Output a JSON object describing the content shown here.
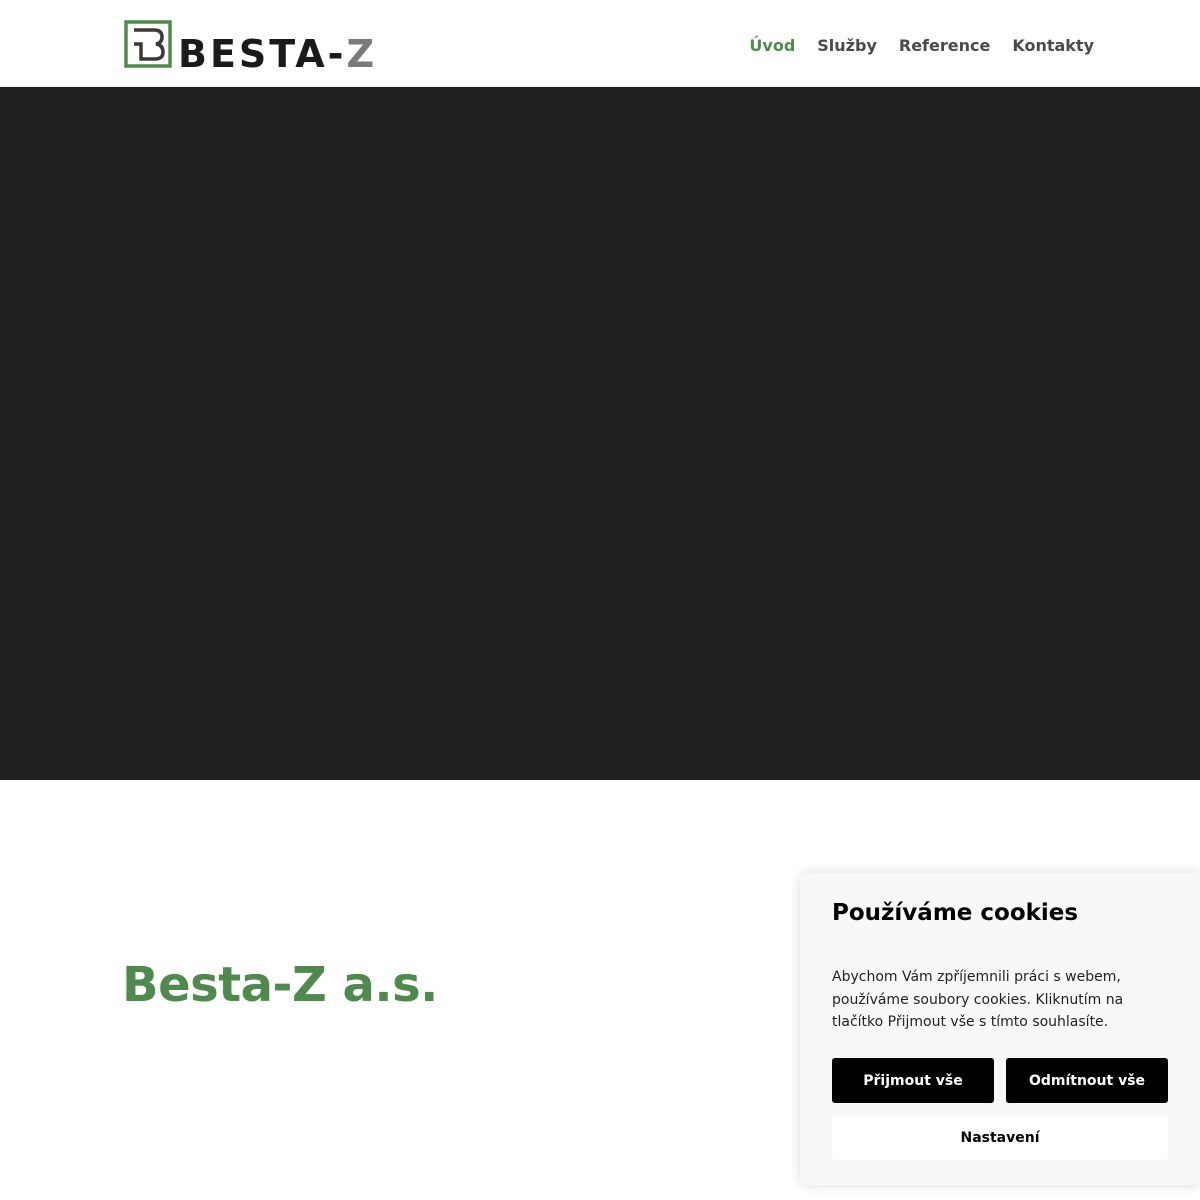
{
  "logo": {
    "text_main": "BESTA-",
    "text_accent": "Z",
    "colors": {
      "mark": "#4e8a4c",
      "text": "#1a1a1a",
      "accent": "#7a7a7a"
    }
  },
  "nav": {
    "items": [
      {
        "label": "Úvod",
        "active": true
      },
      {
        "label": "Služby",
        "active": false
      },
      {
        "label": "Reference",
        "active": false
      },
      {
        "label": "Kontakty",
        "active": false
      }
    ]
  },
  "main": {
    "company_title": "Besta-Z a.s."
  },
  "cookie_banner": {
    "title": "Používáme cookies",
    "text": "Abychom Vám zpříjemnili práci s webem, používáme soubory cookies. Kliknutím na tlačítko Přijmout vše s tímto souhlasíte.",
    "accept_label": "Přijmout vše",
    "reject_label": "Odmítnout vše",
    "settings_label": "Nastavení"
  },
  "colors": {
    "accent": "#4e8a4c",
    "hero_background": "#202020",
    "button_dark": "#000000"
  }
}
